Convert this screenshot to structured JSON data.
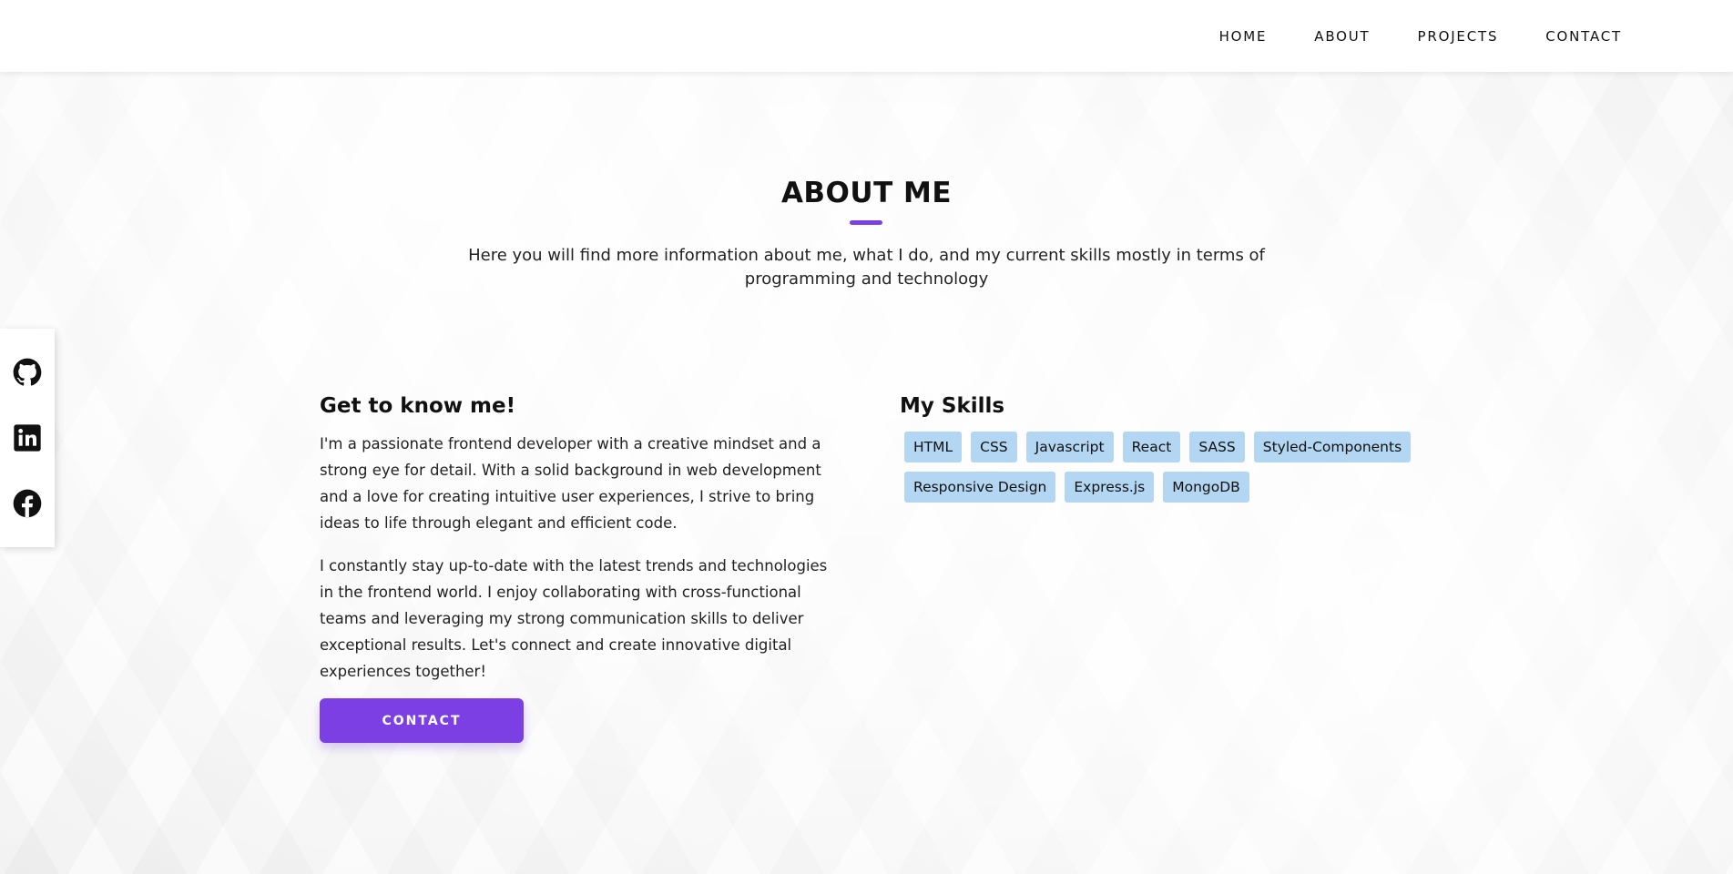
{
  "nav": {
    "items": [
      "HOME",
      "ABOUT",
      "PROJECTS",
      "CONTACT"
    ]
  },
  "social": {
    "icons": [
      "github-icon",
      "linkedin-icon",
      "facebook-icon"
    ]
  },
  "about": {
    "title": "ABOUT ME",
    "subtitle": "Here you will find more information about me, what I do, and my current skills mostly in terms of programming and technology",
    "accent_color": "#7b3fe4"
  },
  "intro": {
    "heading": "Get to know me!",
    "paragraph1": "I'm a passionate frontend developer with a creative mindset and a strong eye for detail. With a solid background in web development and a love for creating intuitive user experiences, I strive to bring ideas to life through elegant and efficient code.",
    "paragraph2": "I constantly stay up-to-date with the latest trends and technologies in the frontend world. I enjoy collaborating with cross-functional teams and leveraging my strong communication skills to deliver exceptional results. Let's connect and create innovative digital experiences together!",
    "button": "CONTACT"
  },
  "skills": {
    "heading": "My Skills",
    "items": [
      "HTML",
      "CSS",
      "Javascript",
      "React",
      "SASS",
      "Styled-Components",
      "Responsive Design",
      "Express.js",
      "MongoDB"
    ],
    "badge_color": "#b3d6f2"
  }
}
